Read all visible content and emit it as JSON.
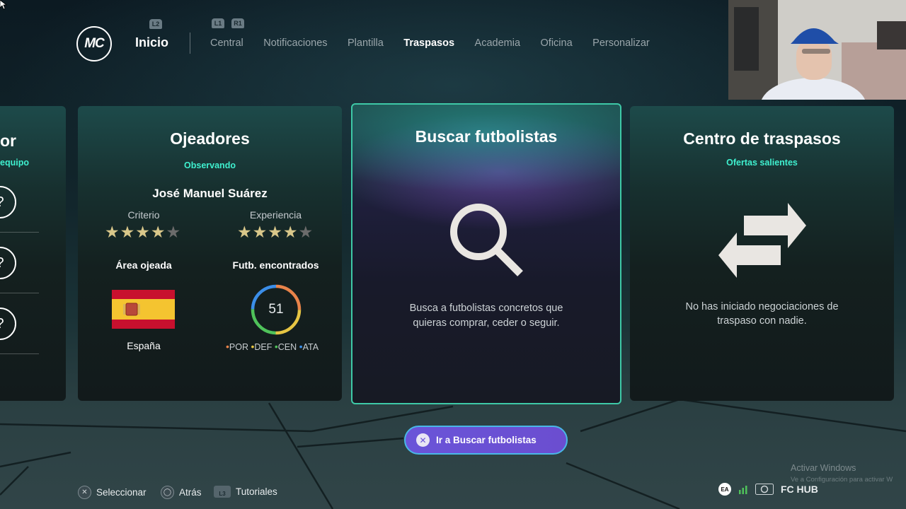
{
  "header": {
    "logo_text": "MC",
    "home_label": "Inicio",
    "hints": {
      "l2": "L2",
      "l1": "L1",
      "r1": "R1"
    },
    "nav": [
      {
        "label": "Central",
        "active": false
      },
      {
        "label": "Notificaciones",
        "active": false
      },
      {
        "label": "Plantilla",
        "active": false
      },
      {
        "label": "Traspasos",
        "active": true
      },
      {
        "label": "Academia",
        "active": false
      },
      {
        "label": "Oficina",
        "active": false
      },
      {
        "label": "Personalizar",
        "active": false
      }
    ]
  },
  "cards": {
    "partial": {
      "title_fragment": "or",
      "sub_fragment": "equipo",
      "question_mark": "?"
    },
    "scouts": {
      "title": "Ojeadores",
      "subtitle": "Observando",
      "scout_name": "José Manuel Suárez",
      "criteria_label": "Criterio",
      "experience_label": "Experiencia",
      "criteria_stars": 4,
      "experience_stars": 4,
      "max_stars": 5,
      "area_label": "Área ojeada",
      "country": "España",
      "found_label": "Futb. encontrados",
      "found_count": "51",
      "legend": [
        "POR",
        "DEF",
        "CEN",
        "ATA"
      ],
      "legend_colors": [
        "#e8834a",
        "#e6c543",
        "#4fc25a",
        "#3b8ee8"
      ]
    },
    "search": {
      "title": "Buscar futbolistas",
      "description_line1": "Busca a futbolistas concretos que",
      "description_line2": "quieras comprar, ceder o seguir."
    },
    "transfers": {
      "title": "Centro de traspasos",
      "subtitle": "Ofertas salientes",
      "description_line1": "No has iniciado negociaciones de",
      "description_line2": "traspaso con nadie."
    }
  },
  "cta": {
    "label": "Ir a Buscar futbolistas"
  },
  "footer": {
    "select": "Seleccionar",
    "back": "Atrás",
    "tutorials": "Tutoriales",
    "touchpad_hint": "L3"
  },
  "watermark": {
    "line1": "Activar Windows",
    "line2": "Ve a Configuración para activar W"
  },
  "hub": {
    "ea": "EA",
    "label": "FC HUB"
  },
  "colors": {
    "accent": "#3ff0cf",
    "focus_border": "#3ec9a7",
    "cta": "#6a54d8"
  }
}
